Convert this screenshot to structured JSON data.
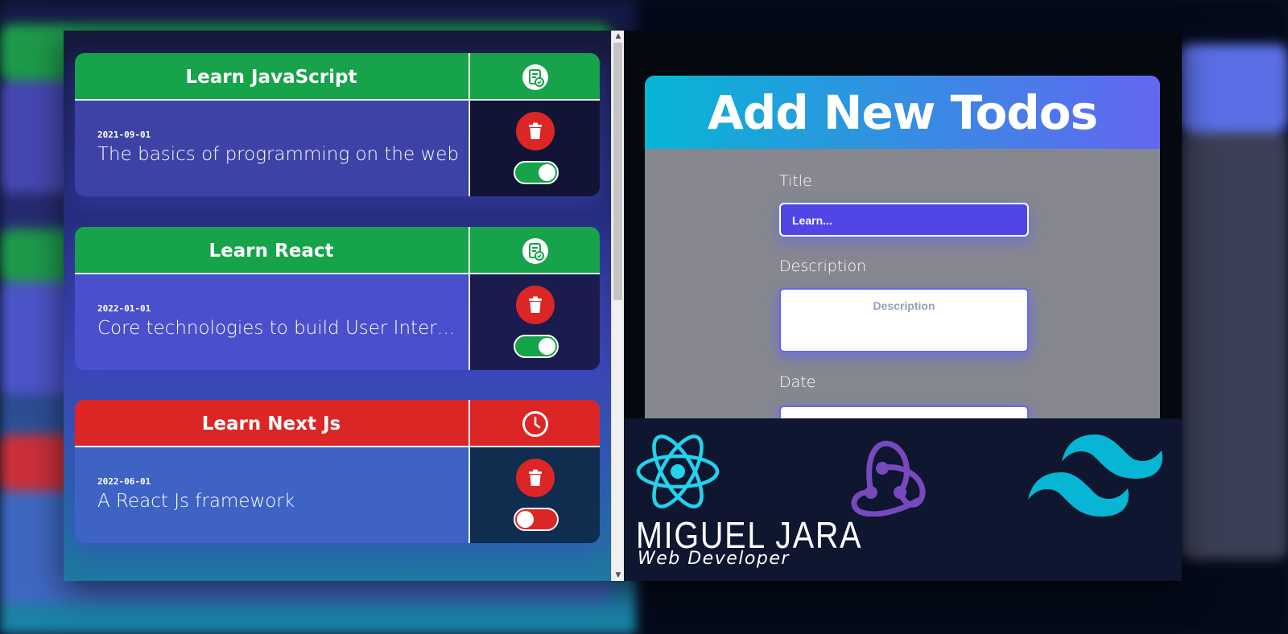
{
  "todo_list": {
    "items": [
      {
        "title": "Learn JavaScript",
        "date": "2021-09-01",
        "description": "The basics of programming on the web",
        "status": "completed",
        "status_icon": "task-completed-icon",
        "toggle_on": true
      },
      {
        "title": "Learn React",
        "date": "2022-01-01",
        "description": "Core technologies to build User Interfac...",
        "status": "completed",
        "status_icon": "task-completed-icon",
        "toggle_on": true
      },
      {
        "title": "Learn Next Js",
        "date": "2022-06-01",
        "description": "A React Js framework",
        "status": "pending",
        "status_icon": "clock-icon",
        "toggle_on": false
      }
    ]
  },
  "form": {
    "heading": "Add New Todos",
    "title_label": "Title",
    "title_value": "Learn...",
    "description_label": "Description",
    "description_placeholder": "Description",
    "date_label": "Date"
  },
  "brand": {
    "name": "MIGUEL JARA",
    "role": "Web Developer",
    "logos": [
      "react-logo-icon",
      "redux-logo-icon",
      "tailwind-logo-icon"
    ]
  },
  "colors": {
    "completed": "#16a34a",
    "pending": "#dc2626",
    "delete": "#dc2626",
    "accent": "#6366f1",
    "header_gradient_start": "#06b6d4",
    "header_gradient_end": "#6366f1",
    "logo_cyan": "#22d3ee",
    "redux_purple": "#764abc",
    "tailwind_cyan": "#06b6d4"
  }
}
